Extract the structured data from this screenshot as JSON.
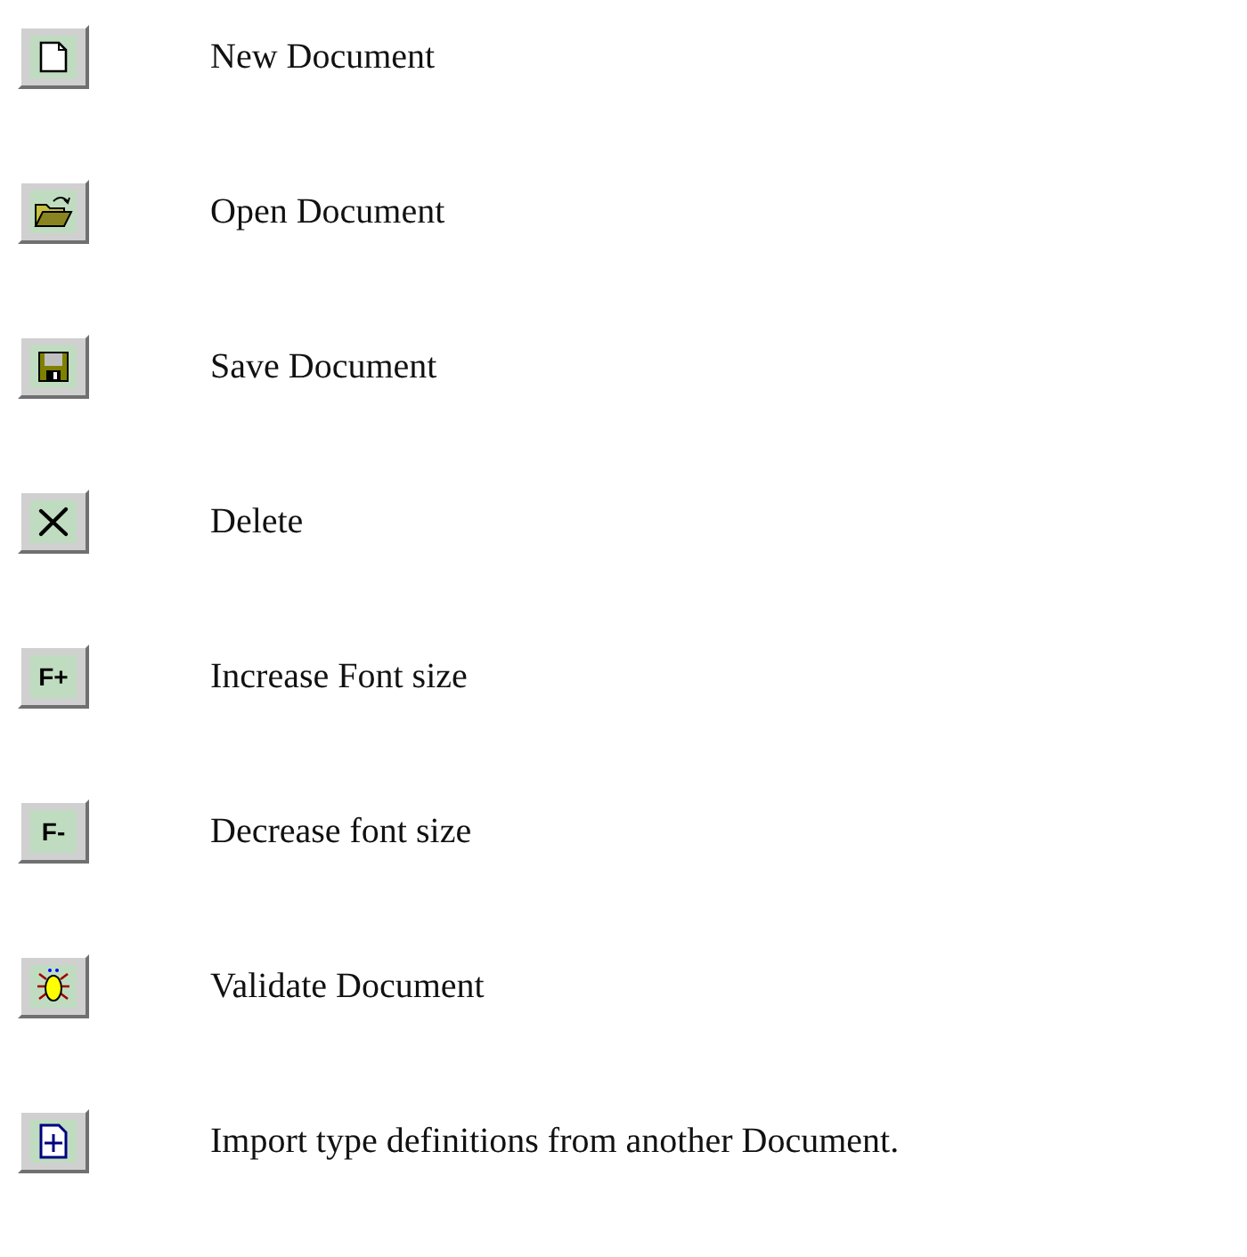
{
  "items": [
    {
      "kind": "new",
      "label": "New Document"
    },
    {
      "kind": "open",
      "label": "Open Document"
    },
    {
      "kind": "save",
      "label": "Save Document"
    },
    {
      "kind": "delete",
      "label": "Delete"
    },
    {
      "kind": "glyph",
      "glyph": "F+",
      "label": "Increase Font size"
    },
    {
      "kind": "glyph",
      "glyph": "F-",
      "label": "Decrease font size"
    },
    {
      "kind": "validate",
      "label": "Validate Document"
    },
    {
      "kind": "import",
      "label": "Import type definitions from another Document."
    }
  ]
}
